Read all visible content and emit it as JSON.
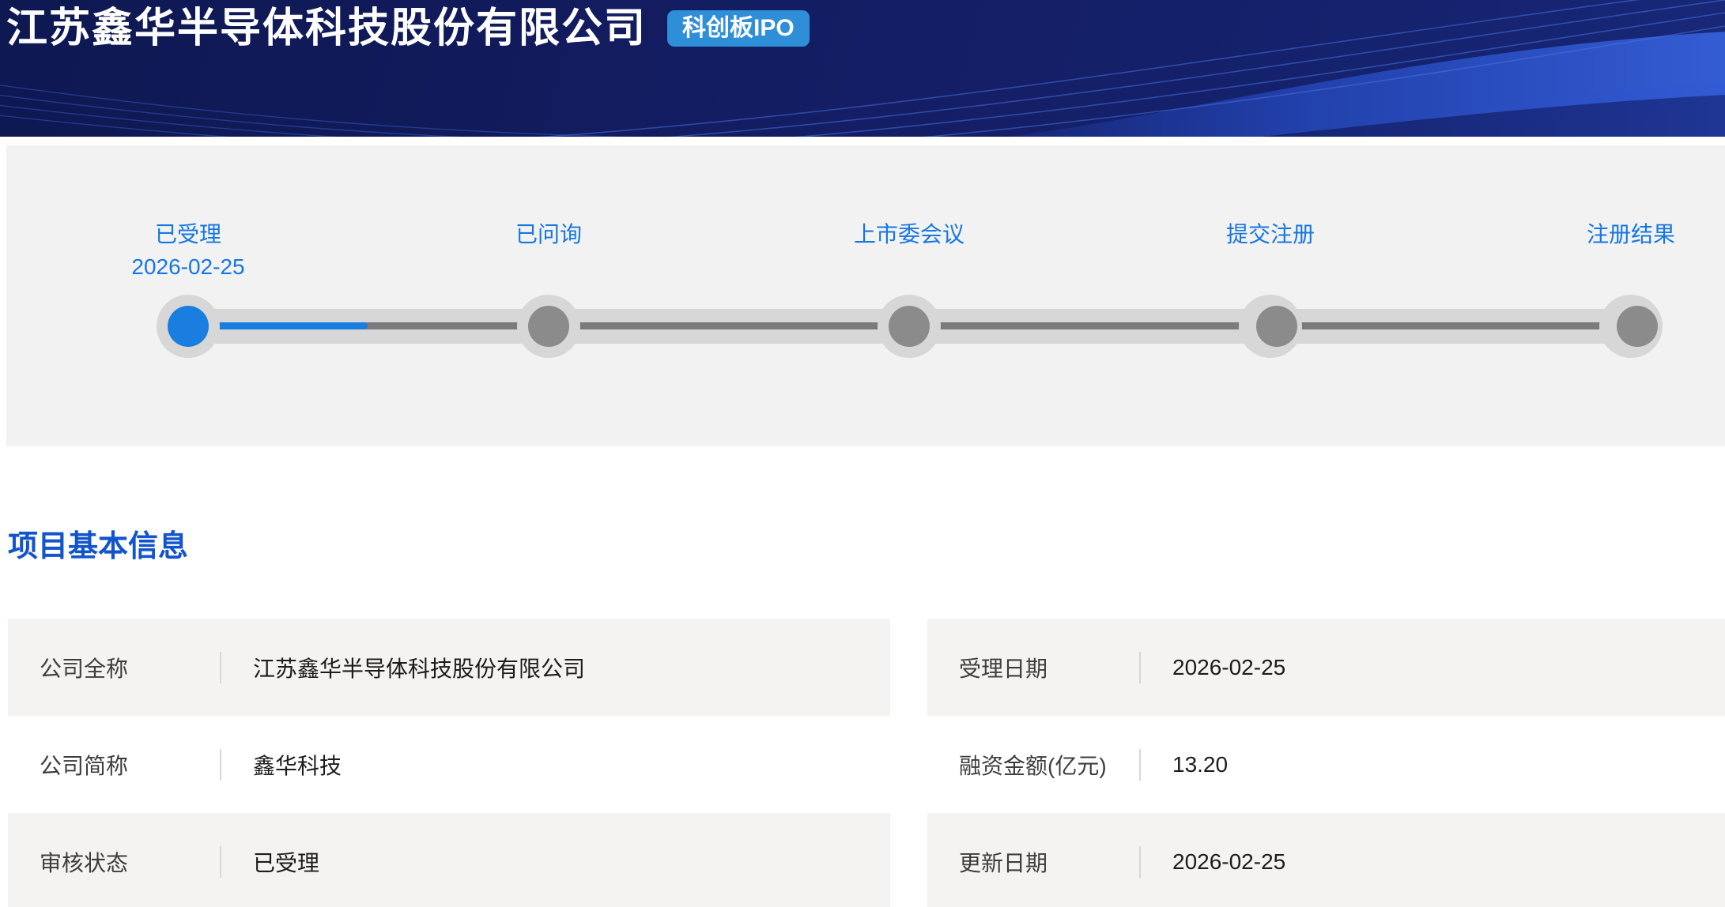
{
  "header": {
    "title": "江苏鑫华半导体科技股份有限公司",
    "badge": "科创板IPO"
  },
  "timeline": {
    "steps": [
      {
        "label": "已受理",
        "date": "2026-02-25",
        "state": "active"
      },
      {
        "label": "已问询",
        "date": "",
        "state": "pending"
      },
      {
        "label": "上市委会议",
        "date": "",
        "state": "pending"
      },
      {
        "label": "提交注册",
        "date": "",
        "state": "pending"
      },
      {
        "label": "注册结果",
        "date": "",
        "state": "pending"
      }
    ],
    "first_segment_progress": 0.5
  },
  "section": {
    "title": "项目基本信息"
  },
  "info": {
    "left": [
      {
        "label": "公司全称",
        "value": "江苏鑫华半导体科技股份有限公司"
      },
      {
        "label": "公司简称",
        "value": "鑫华科技"
      },
      {
        "label": "审核状态",
        "value": "已受理"
      }
    ],
    "right": [
      {
        "label": "受理日期",
        "value": "2026-02-25"
      },
      {
        "label": "融资金额(亿元)",
        "value": "13.20"
      },
      {
        "label": "更新日期",
        "value": "2026-02-25"
      }
    ]
  },
  "colors": {
    "header_bg": "#131d62",
    "badge_bg": "#2f8ed8",
    "step_text_blue": "#1677e0",
    "active_node_blue": "#1a7ee0",
    "inactive_node_gray": "#8b8b8b",
    "track_band_gray": "#d7d7d7",
    "track_line_gray": "#7b7b7b",
    "panel_bg": "#f2f2f2",
    "row_alt_bg": "#f4f3f1",
    "section_title_blue": "#1254cb"
  }
}
